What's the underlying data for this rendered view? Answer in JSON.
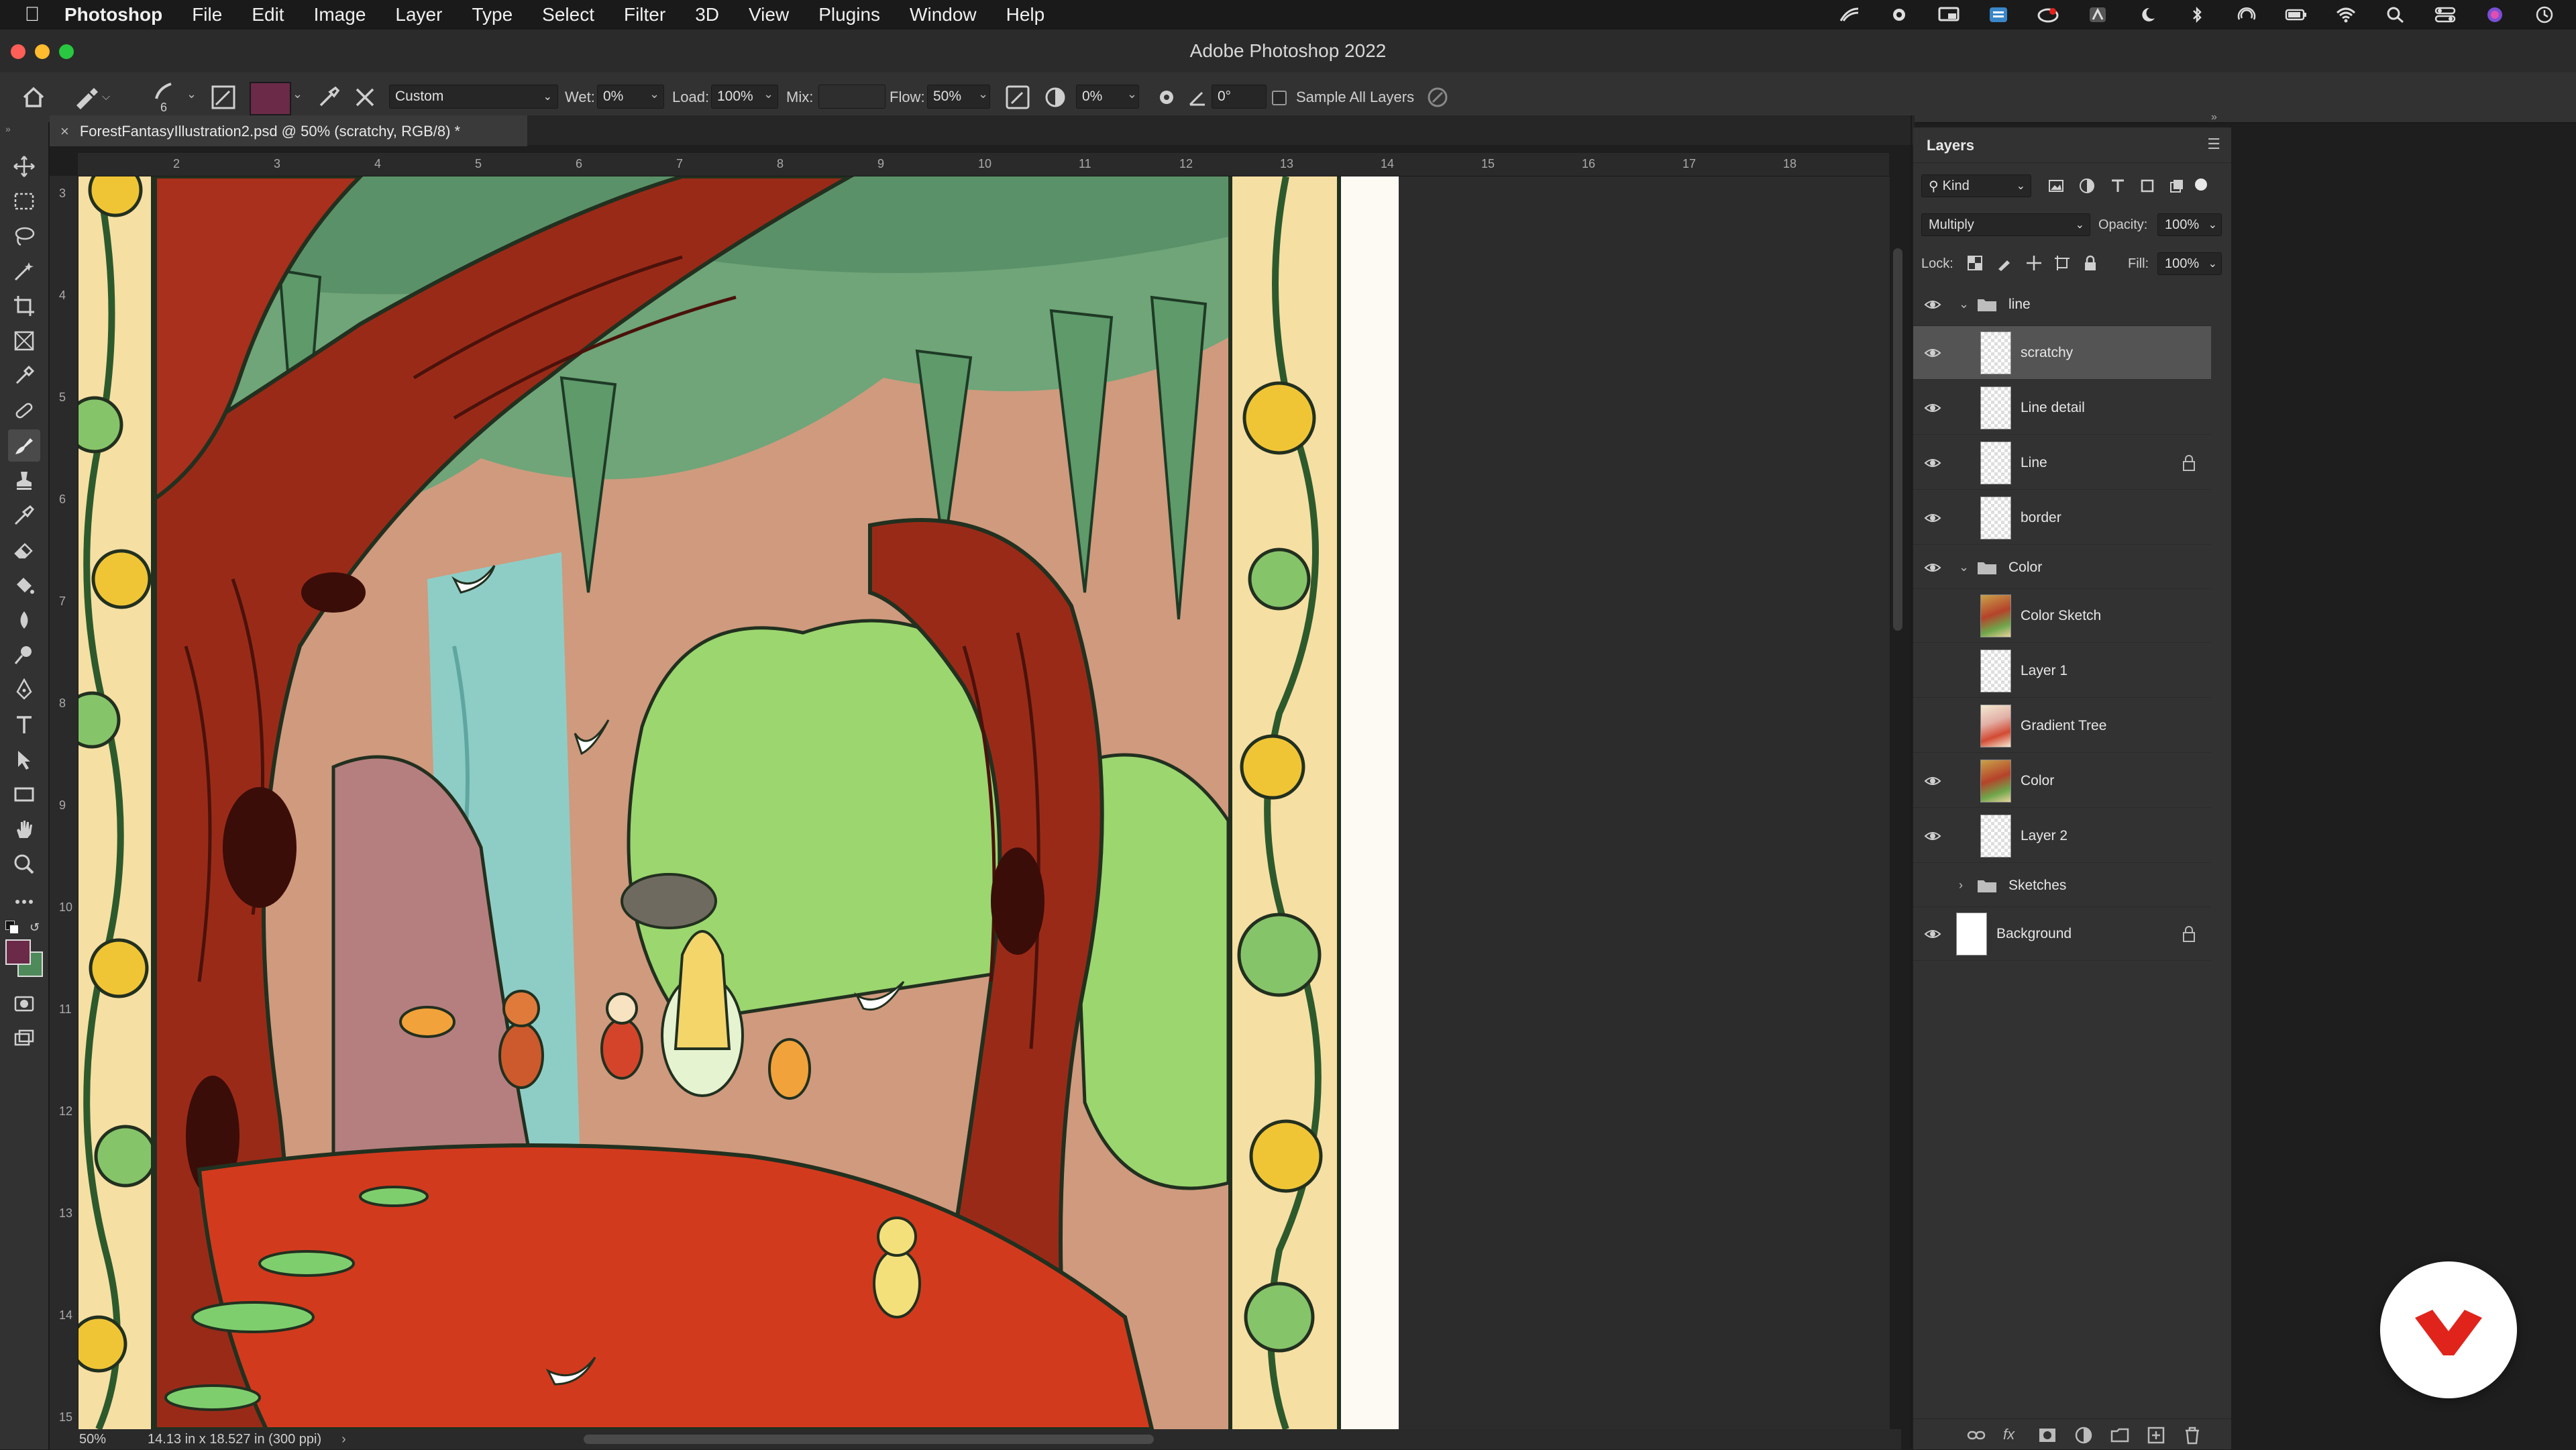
{
  "menubar": {
    "app_name": "Photoshop",
    "items": [
      "File",
      "Edit",
      "Image",
      "Layer",
      "Type",
      "Select",
      "Filter",
      "3D",
      "View",
      "Plugins",
      "Window",
      "Help"
    ]
  },
  "window": {
    "title": "Adobe Photoshop 2022"
  },
  "options_bar": {
    "brush_size": "6",
    "foreground_color": "#6b2a48",
    "preset": "Custom",
    "wet_label": "Wet:",
    "wet_value": "0%",
    "load_label": "Load:",
    "load_value": "100%",
    "mix_label": "Mix:",
    "mix_value": "",
    "flow_label": "Flow:",
    "flow_value": "50%",
    "smoothing_value": "0%",
    "angle_value": "0°",
    "sample_all_layers_label": "Sample All Layers"
  },
  "document": {
    "tab_title": "ForestFantasyIllustration2.psd @ 50% (scratchy, RGB/8) *",
    "zoom": "50%",
    "doc_info": "14.13 in x 18.527 in (300 ppi)",
    "ruler_top": [
      "2",
      "3",
      "4",
      "5",
      "6",
      "7",
      "8",
      "9",
      "10",
      "11",
      "12",
      "13",
      "14",
      "15",
      "16",
      "17",
      "18"
    ],
    "ruler_left": [
      "3",
      "4",
      "5",
      "6",
      "7",
      "8",
      "9",
      "10",
      "11",
      "12",
      "13",
      "14",
      "15"
    ]
  },
  "layers_panel": {
    "title": "Layers",
    "filter_kind": "Kind",
    "blend_mode": "Multiply",
    "opacity_label": "Opacity:",
    "opacity_value": "100%",
    "lock_label": "Lock:",
    "fill_label": "Fill:",
    "fill_value": "100%",
    "layers": [
      {
        "name": "line",
        "kind": "group",
        "visible": true,
        "expanded": true
      },
      {
        "name": "scratchy",
        "kind": "layer",
        "visible": true,
        "selected": true,
        "thumb": "checker"
      },
      {
        "name": "Line detail",
        "kind": "layer",
        "visible": true,
        "thumb": "checker"
      },
      {
        "name": "Line",
        "kind": "layer",
        "visible": true,
        "locked": true,
        "thumb": "checker"
      },
      {
        "name": "border",
        "kind": "layer",
        "visible": true,
        "thumb": "checker"
      },
      {
        "name": "Color",
        "kind": "group",
        "visible": true,
        "expanded": true
      },
      {
        "name": "Color Sketch",
        "kind": "layer",
        "visible": false,
        "thumb": "art"
      },
      {
        "name": "Layer 1",
        "kind": "layer",
        "visible": false,
        "thumb": "checker"
      },
      {
        "name": "Gradient Tree",
        "kind": "layer",
        "visible": false,
        "thumb": "art2"
      },
      {
        "name": "Color",
        "kind": "layer",
        "visible": true,
        "thumb": "art"
      },
      {
        "name": "Layer 2",
        "kind": "layer",
        "visible": true,
        "thumb": "checker"
      },
      {
        "name": "Sketches",
        "kind": "group",
        "visible": false,
        "expanded": false
      },
      {
        "name": "Background",
        "kind": "layer",
        "visible": true,
        "locked": true,
        "thumb": "white"
      }
    ]
  },
  "colors": {
    "accent_red": "#e0241b",
    "panel_bg": "#323232",
    "selected_row": "#545454"
  }
}
